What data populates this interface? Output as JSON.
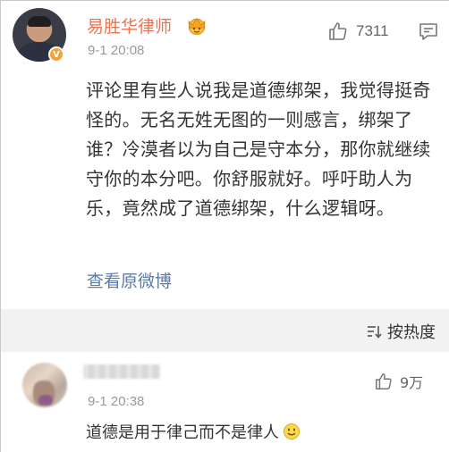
{
  "post": {
    "username": "易胜华律师",
    "time": "9-1 20:08",
    "like_count": "7311",
    "text": "评论里有些人说我是道德绑架，我觉得挺奇怪的。无名无姓无图的一则感言，绑架了谁？冷漠者以为自己是守本分，那你就继续守你的本分吧。你舒服就好。呼吁助人为乐，竟然成了道德绑架，什么逻辑呀。",
    "view_original": "查看原微博",
    "verified_badge": "V",
    "icons": {
      "like": "thumbs-up-icon",
      "comment": "comment-icon",
      "crown": "crown-badge-icon"
    }
  },
  "sort": {
    "label": "按热度",
    "icon": "sort-icon"
  },
  "comment": {
    "time": "9-1 20:38",
    "like_count": "9万",
    "text": "道德是用于律己而不是律人",
    "emoji": "smile-emoji-icon"
  },
  "colors": {
    "username": "#eb7350",
    "link": "#5b7ba8",
    "band": "#f2f2f2",
    "muted": "#999999"
  }
}
